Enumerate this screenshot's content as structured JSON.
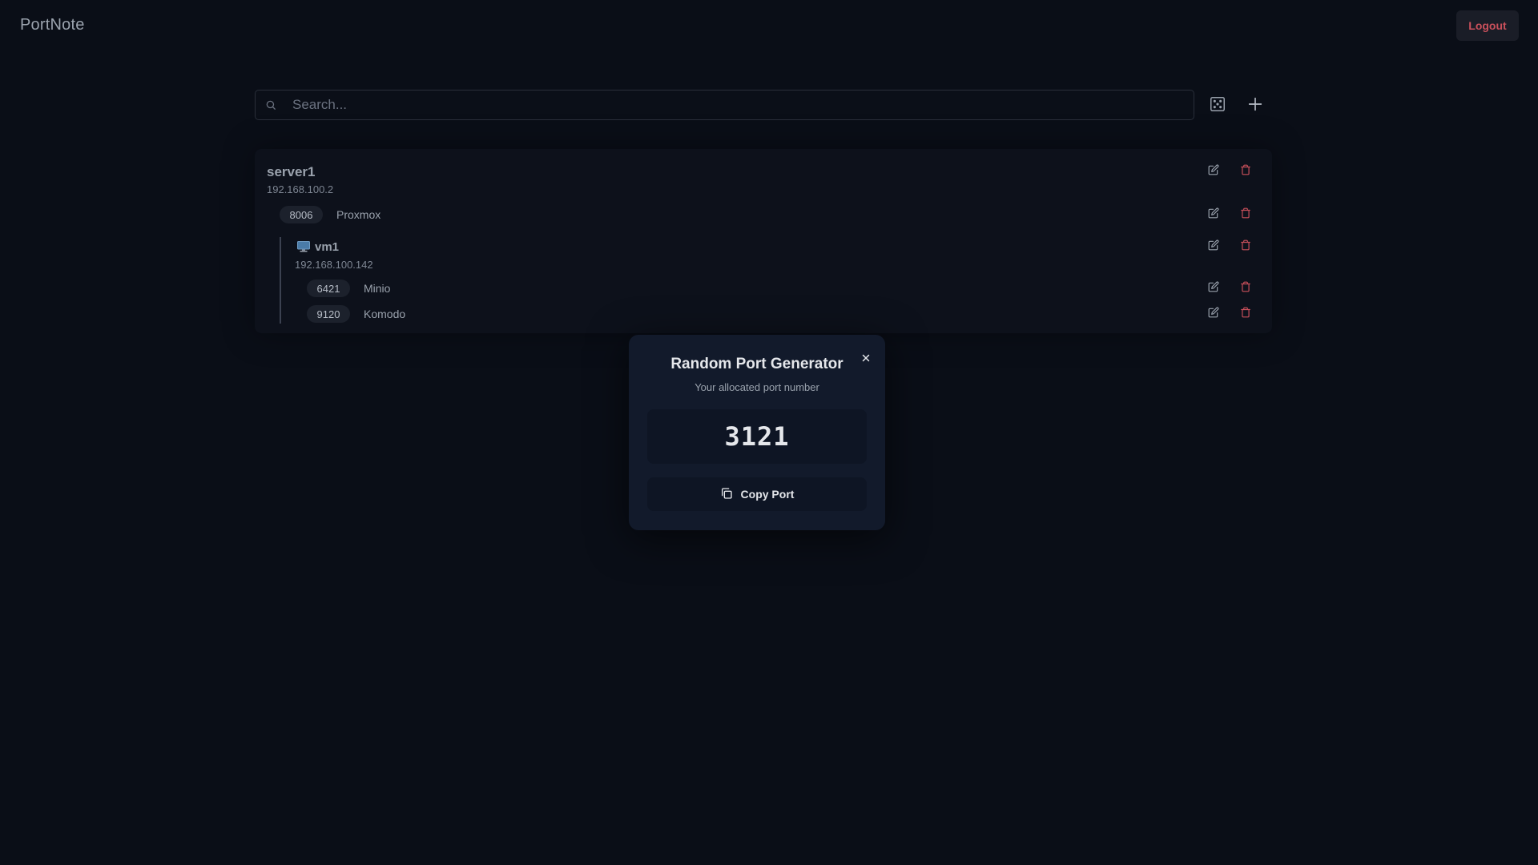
{
  "app": {
    "title": "PortNote",
    "logout_label": "Logout"
  },
  "search": {
    "placeholder": "Search...",
    "value": ""
  },
  "colors": {
    "background": "#0a0e17",
    "danger": "#c9505b",
    "modal_bg": "#121a2b"
  },
  "server": {
    "name": "server1",
    "ip": "192.168.100.2",
    "ports": [
      {
        "port": "8006",
        "label": "Proxmox"
      }
    ],
    "vms": [
      {
        "name": "vm1",
        "ip": "192.168.100.142",
        "icon": "monitor-icon",
        "ports": [
          {
            "port": "6421",
            "label": "Minio"
          },
          {
            "port": "9120",
            "label": "Komodo"
          }
        ]
      }
    ]
  },
  "modal": {
    "title": "Random Port Generator",
    "subtitle": "Your allocated port number",
    "port": "3121",
    "copy_label": "Copy Port"
  }
}
